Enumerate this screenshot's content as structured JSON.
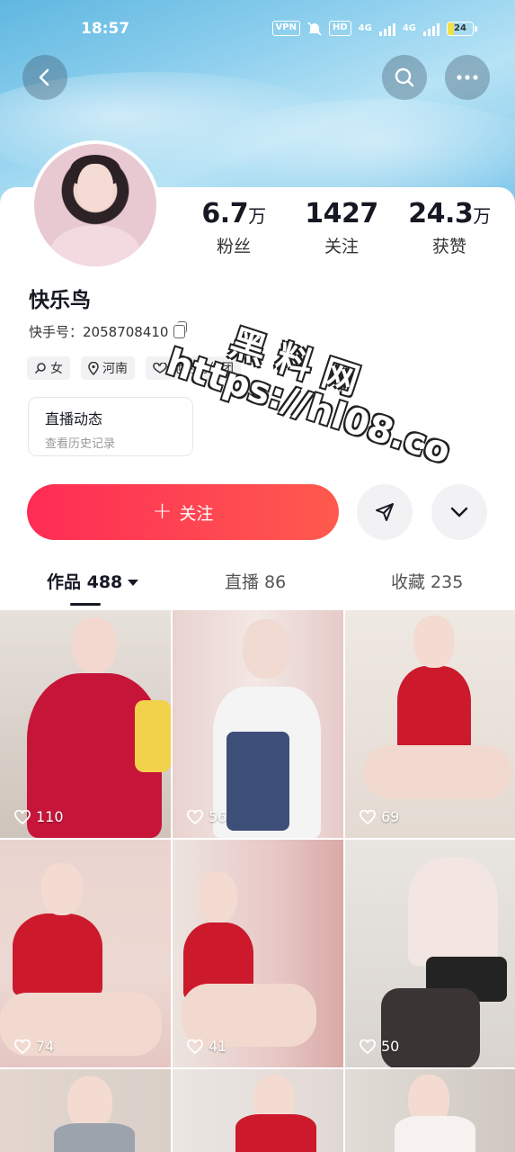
{
  "status_bar": {
    "time": "18:57",
    "vpn": "VPN",
    "hd": "HD",
    "net1": "4G",
    "net2": "4G",
    "battery": "24"
  },
  "header": {
    "back_icon": "chevron-left-icon",
    "search_icon": "search-icon",
    "more_icon": "more-dots-icon"
  },
  "profile": {
    "name": "快乐鸟",
    "uid_label": "快手号：",
    "uid": "2058708410",
    "stats": [
      {
        "value": "6.7",
        "unit": "万",
        "label": "粉丝"
      },
      {
        "value": "1427",
        "unit": "",
        "label": "关注"
      },
      {
        "value": "24.3",
        "unit": "万",
        "label": "获赞"
      }
    ],
    "chips": [
      {
        "icon": "female-icon",
        "label": "女"
      },
      {
        "icon": "location-icon",
        "label": "河南"
      },
      {
        "icon": "fan-club-icon",
        "label": "她的粉丝团"
      }
    ],
    "live": {
      "title": "直播动态",
      "subtitle": "查看历史记录"
    }
  },
  "actions": {
    "follow": "关注",
    "share_icon": "send-icon",
    "expand_icon": "chevron-down-icon"
  },
  "tabs": [
    {
      "label": "作品 488"
    },
    {
      "label": "直播 86"
    },
    {
      "label": "收藏 235"
    }
  ],
  "works": [
    {
      "likes": "110"
    },
    {
      "likes": "56"
    },
    {
      "likes": "69"
    },
    {
      "likes": "74"
    },
    {
      "likes": "41"
    },
    {
      "likes": "50"
    }
  ],
  "watermark": {
    "line1": "黑料网",
    "line2": "https://hl08.co"
  },
  "colors": {
    "accent": "#fe2c55",
    "sky": "#8fd0ee"
  }
}
